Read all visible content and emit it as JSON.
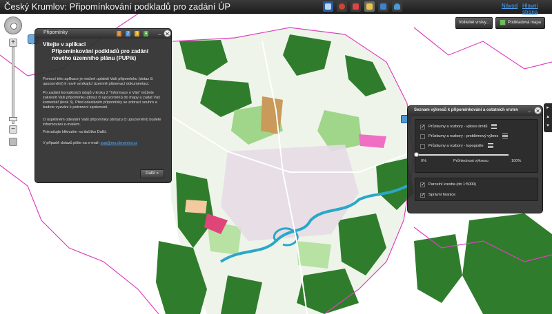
{
  "header": {
    "title": "Český Krumlov: Připomínkování podkladů pro zadání ÚP",
    "help_link": "Návod",
    "home_link": "Hlavní strana",
    "toolbar_icons": [
      "identify-icon",
      "measure-icon",
      "draw-icon",
      "print-icon",
      "export-icon",
      "layers-icon"
    ]
  },
  "comments_panel": {
    "title": "Připomínky",
    "steps": [
      "1",
      "2",
      "3",
      "4"
    ],
    "step_colors": [
      "#d9822b",
      "#4a90d9",
      "#e0a526",
      "#58a84c"
    ],
    "welcome": "Vítejte v aplikaci",
    "app_heading": "Připomínkování podkladů pro zadání nového územního plánu (PUPík)",
    "paragraphs": [
      "Pomocí této aplikace je možné uplatnit Vaši připomínku (dotaz či upozornění) k nově vznikající územně plánovací dokumentaci.",
      "Po zadání kontaktních údajů v kroku 2 \"Informace o Vás\" můžete zakreslit Vaši připomínku (dotaz či upozornění) do mapy a zadat Váš komentář (krok 3). Před odesláním připomínky se zobrazí souhrn a budete vyzváni k potvrzení správnosti.",
      "O úspěšném odeslání Vaší připomínky (dotazu či upozornění) budete informováni e-mailem.",
      "Pokračujte kliknutím na tlačítko Další."
    ],
    "contact_prefix": "V případě dotazů pište na e-mail:",
    "contact_email": "pup@mu.ckrumlov.cz",
    "next_label": "Další »"
  },
  "map_buttons": {
    "optional_layers": "Volitelné vrstvy...",
    "basemap": "Podkladová mapa"
  },
  "layers_panel": {
    "title": "Seznam výkresů k připomínkování a ostatních vrstev",
    "drawings": [
      {
        "label": "Průzkumy a rozbory - výkres limitů",
        "checked": true
      },
      {
        "label": "Průzkumy a rozbory - problémový výkres",
        "checked": false
      },
      {
        "label": "Průzkumy a rozbory - topografie",
        "checked": false
      }
    ],
    "transparency": {
      "min": "0%",
      "label": "Průhlednost výkresu",
      "max": "100%",
      "value": 0
    },
    "other_layers": [
      {
        "label": "Parcelní kresba (do 1:5000)",
        "checked": true
      },
      {
        "label": "Správní hranice",
        "checked": true
      }
    ]
  },
  "colors": {
    "forest": "#2f7d2c",
    "meadow": "#7cc46a",
    "boundary": "#e040c0",
    "river": "#2aa7c9",
    "panel": "#303030",
    "link": "#4aa7ff"
  }
}
